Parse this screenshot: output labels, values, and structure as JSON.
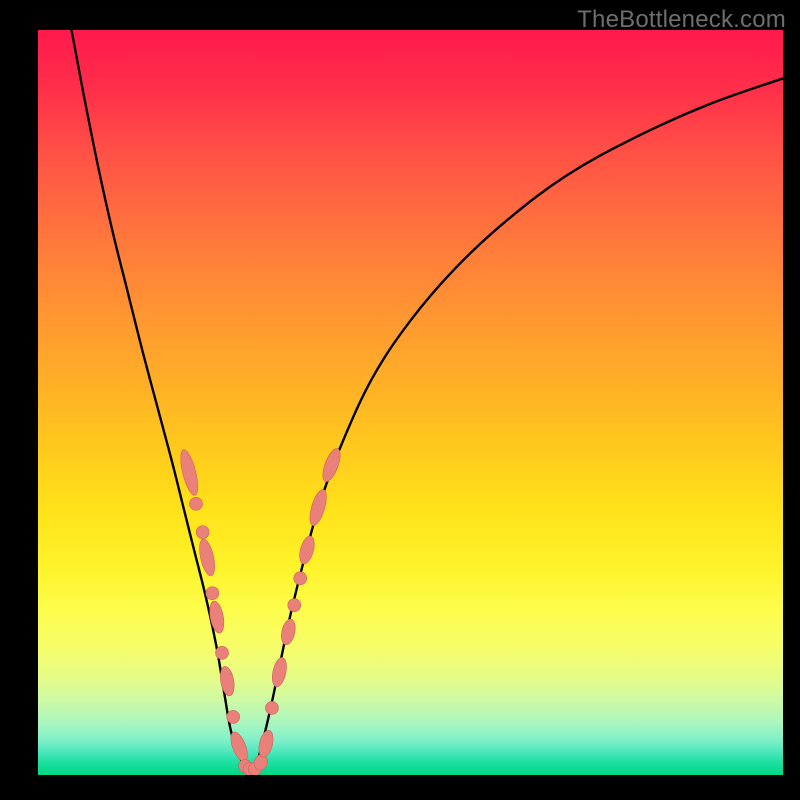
{
  "attribution": "TheBottleneck.com",
  "colors": {
    "page_bg": "#000000",
    "curve_stroke": "#000000",
    "marker_fill": "#e98079",
    "marker_stroke": "#cf615b",
    "gradient_top": "#ff1a4d",
    "gradient_bottom": "#00d985"
  },
  "chart_data": {
    "type": "line",
    "title": "",
    "xlabel": "",
    "ylabel": "",
    "xlim": [
      0,
      100
    ],
    "ylim": [
      0,
      100
    ],
    "grid": false,
    "legend": false,
    "series": [
      {
        "name": "left-curve",
        "x": [
          4.5,
          6,
          8,
          10,
          12,
          14,
          16,
          18,
          19.5,
          21,
          22.5,
          24,
          25,
          26,
          27.5,
          28.5
        ],
        "y": [
          100,
          92,
          82,
          73,
          65,
          57,
          49.5,
          42,
          36,
          30,
          24,
          17,
          11,
          5.5,
          1.5,
          0
        ]
      },
      {
        "name": "right-curve",
        "x": [
          28.5,
          29.5,
          31,
          32.5,
          34,
          36,
          38,
          41,
          45,
          50,
          56,
          63,
          71,
          80,
          90,
          100
        ],
        "y": [
          0,
          2,
          8,
          15,
          22,
          30,
          37,
          45,
          53.5,
          61,
          68,
          74.5,
          80.5,
          85.5,
          90,
          93.5
        ]
      }
    ],
    "markers": [
      {
        "x": 20.3,
        "y": 40.6,
        "stretch": 6.2
      },
      {
        "x": 21.2,
        "y": 36.4,
        "stretch": 1.0
      },
      {
        "x": 22.1,
        "y": 32.6,
        "stretch": 1.0
      },
      {
        "x": 22.7,
        "y": 29.2,
        "stretch": 4.8
      },
      {
        "x": 23.4,
        "y": 24.4,
        "stretch": 1.0
      },
      {
        "x": 24.0,
        "y": 21.2,
        "stretch": 4.0
      },
      {
        "x": 24.7,
        "y": 16.4,
        "stretch": 1.0
      },
      {
        "x": 25.4,
        "y": 12.6,
        "stretch": 3.6
      },
      {
        "x": 26.2,
        "y": 7.8,
        "stretch": 1.0
      },
      {
        "x": 27.0,
        "y": 3.8,
        "stretch": 3.8
      },
      {
        "x": 27.8,
        "y": 1.2,
        "stretch": 1.0
      },
      {
        "x": 28.4,
        "y": 0.8,
        "stretch": 1.0
      },
      {
        "x": 29.1,
        "y": 0.8,
        "stretch": 1.0
      },
      {
        "x": 29.9,
        "y": 1.7,
        "stretch": 1.4
      },
      {
        "x": 30.6,
        "y": 4.2,
        "stretch": 3.2
      },
      {
        "x": 31.4,
        "y": 9.0,
        "stretch": 1.0
      },
      {
        "x": 32.4,
        "y": 13.8,
        "stretch": 3.6
      },
      {
        "x": 33.6,
        "y": 19.2,
        "stretch": 3.0
      },
      {
        "x": 34.4,
        "y": 22.8,
        "stretch": 1.0
      },
      {
        "x": 35.2,
        "y": 26.4,
        "stretch": 1.0
      },
      {
        "x": 36.1,
        "y": 30.2,
        "stretch": 3.4
      },
      {
        "x": 37.6,
        "y": 35.9,
        "stretch": 4.8
      },
      {
        "x": 39.4,
        "y": 41.6,
        "stretch": 4.4
      }
    ],
    "marker_radius": 6.5
  }
}
